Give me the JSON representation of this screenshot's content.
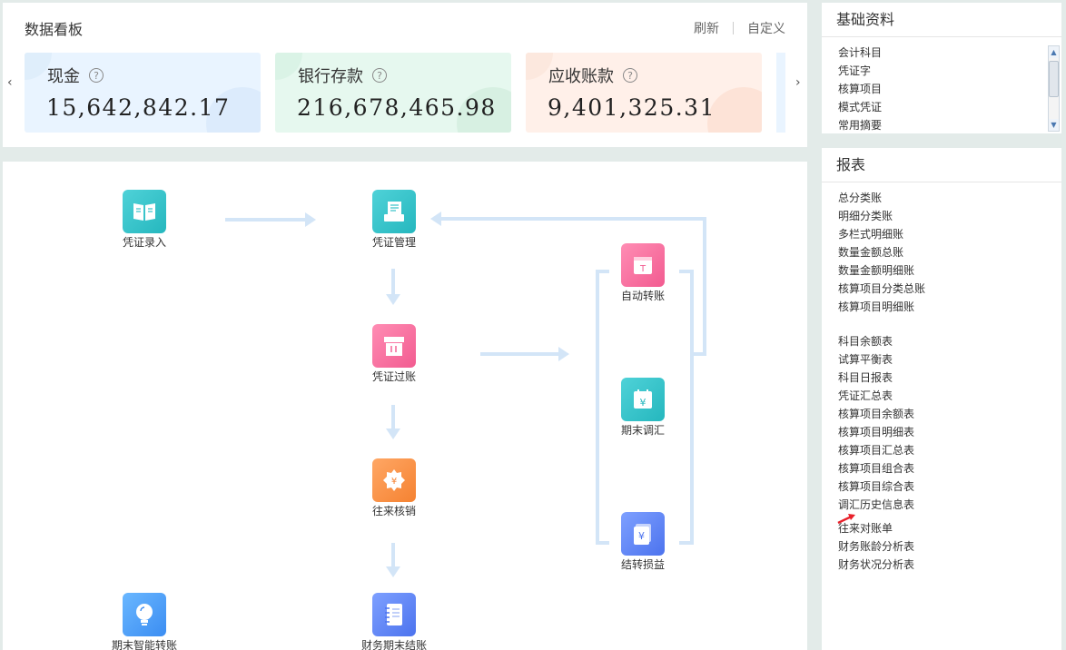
{
  "dashboard": {
    "title": "数据看板",
    "refresh_label": "刷新",
    "customize_label": "自定义",
    "prev_arrow": "‹",
    "next_arrow": "›",
    "cards": [
      {
        "label": "现金",
        "value": "15,642,842.17",
        "help": "?"
      },
      {
        "label": "银行存款",
        "value": "216,678,465.98",
        "help": "?"
      },
      {
        "label": "应收账款",
        "value": "9,401,325.31",
        "help": "?"
      }
    ]
  },
  "flow": {
    "nodes": {
      "voucher_entry": {
        "label": "凭证录入",
        "icon": "book-icon"
      },
      "voucher_manage": {
        "label": "凭证管理",
        "icon": "printer-icon"
      },
      "voucher_post": {
        "label": "凭证过账",
        "icon": "inbox-icon"
      },
      "writeoff": {
        "label": "往来核销",
        "icon": "badge-yen-icon"
      },
      "period_close": {
        "label": "财务期末结账",
        "icon": "notebook-icon"
      },
      "smart_transfer": {
        "label": "期末智能转账",
        "icon": "lightbulb-icon"
      },
      "auto_transfer": {
        "label": "自动转账",
        "icon": "calendar-t-icon"
      },
      "exchange_adjust": {
        "label": "期末调汇",
        "icon": "calendar-yen-icon"
      },
      "profit_transfer": {
        "label": "结转损益",
        "icon": "cards-yen-icon"
      }
    }
  },
  "basic": {
    "title": "基础资料",
    "items": [
      "会计科目",
      "凭证字",
      "核算项目",
      "模式凭证",
      "常用摘要"
    ],
    "scroll_up": "▲",
    "scroll_down": "▼"
  },
  "reports": {
    "title": "报表",
    "group1": [
      "总分类账",
      "明细分类账",
      "多栏式明细账",
      "数量金额总账",
      "数量金额明细账",
      "核算项目分类总账",
      "核算项目明细账"
    ],
    "group2": [
      "科目余额表",
      "试算平衡表",
      "科目日报表",
      "凭证汇总表",
      "核算项目余额表",
      "核算项目明细表",
      "核算项目汇总表",
      "核算项目组合表",
      "核算项目综合表",
      "调汇历史信息表"
    ],
    "group3": [
      "往来对账单",
      "财务账龄分析表",
      "财务状况分析表"
    ]
  },
  "colors": {
    "flow_arrow": "#d3e5f7",
    "teal": "#25b7be",
    "pink": "#f25b90",
    "orange": "#f58231",
    "blue": "#4c73ee",
    "pointer_arrow": "#e8202a"
  }
}
